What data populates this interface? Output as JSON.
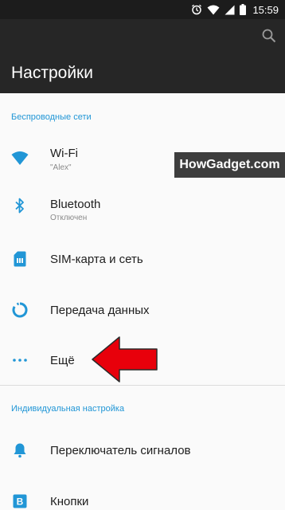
{
  "status_bar": {
    "time": "15:59",
    "icons": [
      "alarm-icon",
      "wifi-icon",
      "signal-icon",
      "battery-icon"
    ]
  },
  "toolbar": {
    "title": "Настройки",
    "search_icon": "search-icon"
  },
  "sections": [
    {
      "header": "Беспроводные сети",
      "items": [
        {
          "title": "Wi-Fi",
          "subtitle": "\"Alex\"",
          "icon": "wifi-icon"
        },
        {
          "title": "Bluetooth",
          "subtitle": "Отключен",
          "icon": "bluetooth-icon"
        },
        {
          "title": "SIM-карта и сеть",
          "icon": "sim-card-icon"
        },
        {
          "title": "Передача данных",
          "icon": "data-usage-icon"
        },
        {
          "title": "Ещё",
          "icon": "more-dots-icon"
        }
      ]
    },
    {
      "header": "Индивидуальная настройка",
      "items": [
        {
          "title": "Переключатель сигналов",
          "icon": "alert-slider-icon"
        },
        {
          "title": "Кнопки",
          "icon": "buttons-icon"
        }
      ]
    }
  ],
  "watermark": "HowGadget.com",
  "annotation": {
    "arrow_color": "#e8000b",
    "target": "Ещё"
  },
  "colors": {
    "accent": "#2196d6",
    "toolbar": "#262626",
    "statusbar": "#1c1c1c"
  }
}
